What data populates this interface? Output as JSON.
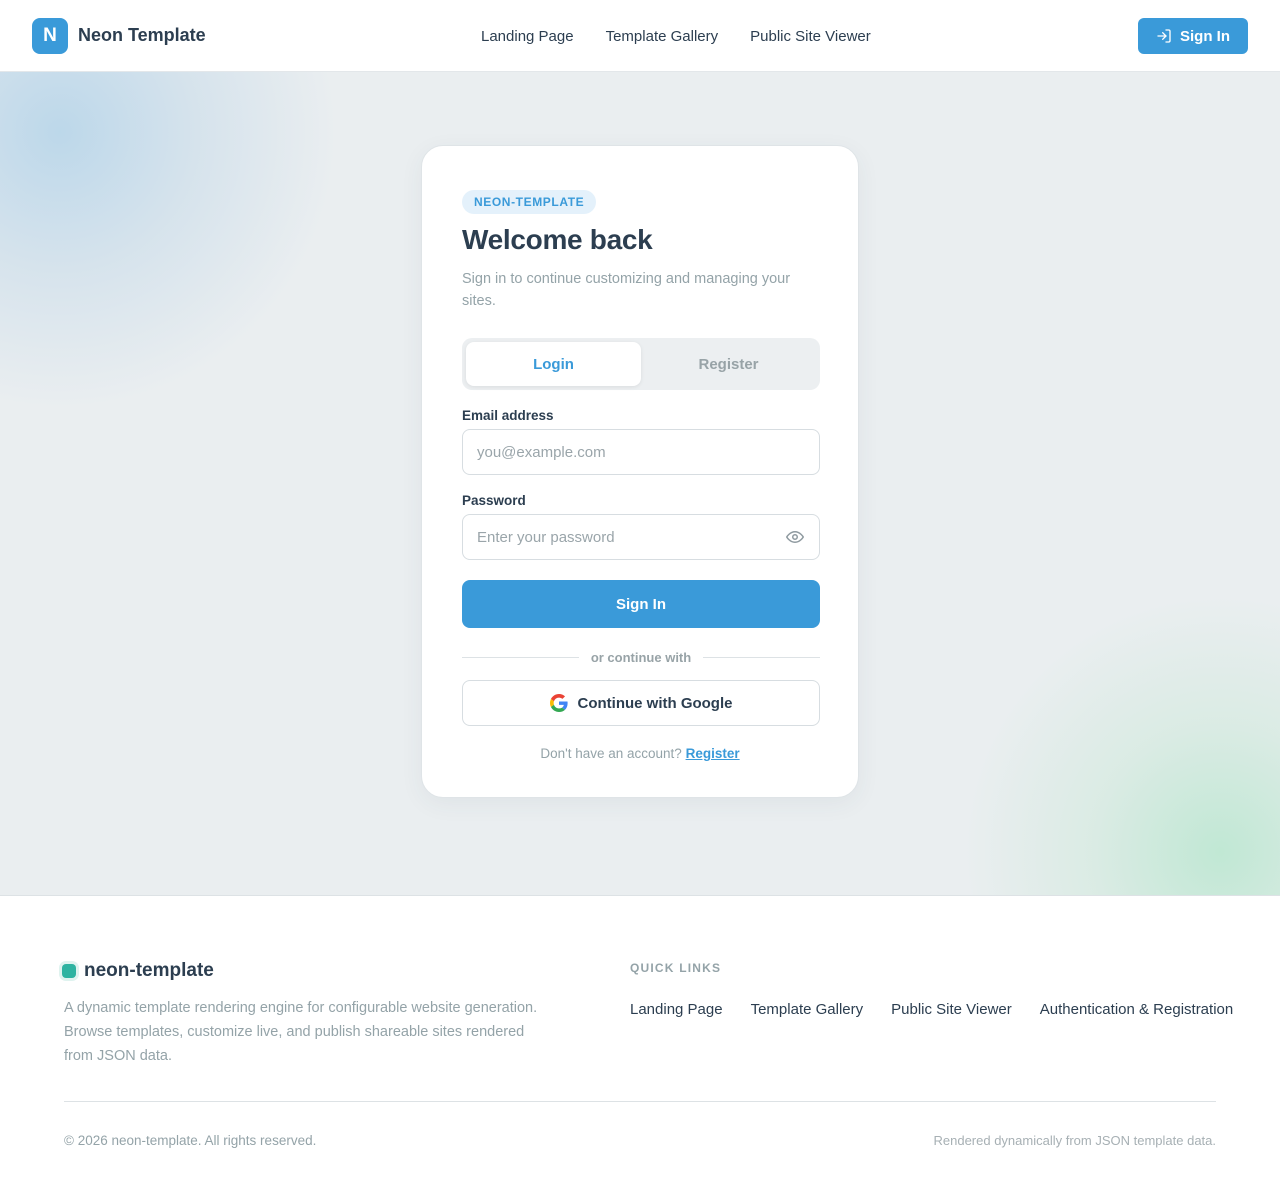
{
  "header": {
    "logo_letter": "N",
    "brand_name": "Neon Template",
    "nav": [
      "Landing Page",
      "Template Gallery",
      "Public Site Viewer"
    ],
    "signin_label": "Sign In",
    "signin_icon": "login-icon"
  },
  "card": {
    "badge": "NEON-TEMPLATE",
    "title": "Welcome back",
    "subtitle": "Sign in to continue customizing and managing your sites.",
    "tabs": [
      {
        "label": "Login",
        "active": true
      },
      {
        "label": "Register",
        "active": false
      }
    ],
    "email": {
      "label": "Email address",
      "placeholder": "you@example.com",
      "value": ""
    },
    "password": {
      "label": "Password",
      "placeholder": "Enter your password",
      "value": "",
      "toggle_icon": "eye-icon"
    },
    "submit_label": "Sign In",
    "divider_text": "or continue with",
    "google_label": "Continue with Google",
    "google_icon": "google-icon",
    "switch_prompt": "Don't have an account?",
    "switch_link": "Register"
  },
  "footer": {
    "brand": "neon-template",
    "description": "A dynamic template rendering engine for configurable website generation. Browse templates, customize live, and publish shareable sites rendered from JSON data.",
    "quick_links_title": "QUICK LINKS",
    "quick_links": [
      "Landing Page",
      "Template Gallery",
      "Public Site Viewer",
      "Authentication & Registration"
    ],
    "copyright": "© 2026 neon-template. All rights reserved.",
    "rendered_note": "Rendered dynamically from JSON template data."
  },
  "colors": {
    "accent": "#3a9ad9",
    "text": "#2c3e50",
    "muted": "#94a3a8",
    "hero_bg": "#eaeef0",
    "footer_dot": "#2eb3a1"
  }
}
